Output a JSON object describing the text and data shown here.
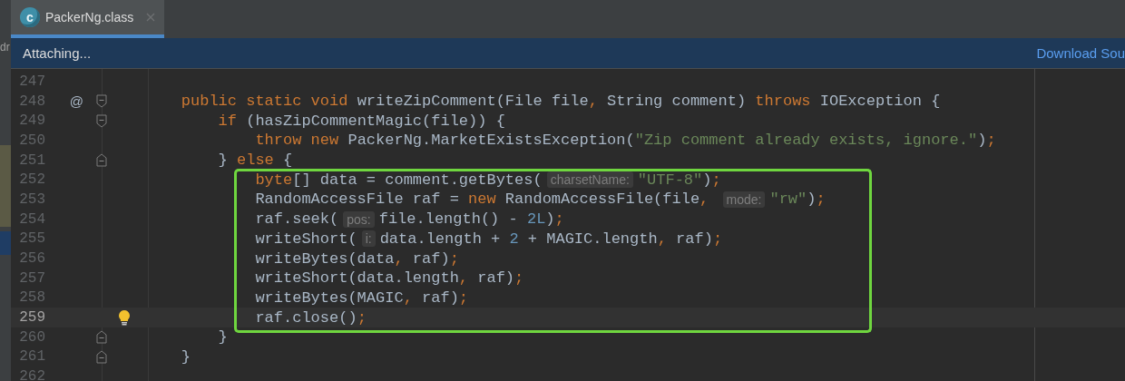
{
  "side_panel": {
    "text": "dr"
  },
  "tabs": [
    {
      "label": "PackerNg.class",
      "icon_text": "c",
      "selected": true,
      "closable": true
    }
  ],
  "banner": {
    "message": "Attaching...",
    "link": "Download Sou"
  },
  "lines": [
    {
      "number": "247",
      "current": false,
      "boxed": false,
      "bulb": false,
      "fold_open": false,
      "fold_close": false
    },
    {
      "number": "248",
      "current": false,
      "boxed": false,
      "bulb": false,
      "fold_open": true,
      "fold_close": false,
      "marker": "@",
      "tokens": [
        {
          "kind": "keyword",
          "text": "    public static void "
        },
        {
          "kind": "plain",
          "text": "writeZipComment(File file"
        },
        {
          "kind": "keyword",
          "text": ", "
        },
        {
          "kind": "plain",
          "text": "String comment) "
        },
        {
          "kind": "keyword",
          "text": "throws "
        },
        {
          "kind": "plain",
          "text": "IOException {"
        }
      ]
    },
    {
      "number": "249",
      "current": false,
      "boxed": false,
      "bulb": false,
      "fold_open": true,
      "fold_close": false,
      "tokens": [
        {
          "kind": "keyword",
          "text": "        if "
        },
        {
          "kind": "plain",
          "text": "(hasZipCommentMagic(file)) {"
        }
      ]
    },
    {
      "number": "250",
      "current": false,
      "boxed": false,
      "bulb": false,
      "fold_open": false,
      "fold_close": false,
      "tokens": [
        {
          "kind": "keyword",
          "text": "            throw new "
        },
        {
          "kind": "plain",
          "text": "PackerNg.MarketExistsException("
        },
        {
          "kind": "string",
          "text": "\"Zip comment already exists, ignore.\""
        },
        {
          "kind": "plain",
          "text": ")"
        },
        {
          "kind": "keyword",
          "text": ";"
        }
      ]
    },
    {
      "number": "251",
      "current": false,
      "boxed": false,
      "bulb": false,
      "fold_open": false,
      "fold_close": true,
      "tokens": [
        {
          "kind": "plain",
          "text": "        } "
        },
        {
          "kind": "keyword",
          "text": "else "
        },
        {
          "kind": "plain",
          "text": "{"
        }
      ]
    },
    {
      "number": "252",
      "current": false,
      "boxed": true,
      "bulb": false,
      "fold_open": false,
      "fold_close": false,
      "tokens": [
        {
          "kind": "keyword",
          "text": "            byte"
        },
        {
          "kind": "plain",
          "text": "[] data = comment.getBytes("
        },
        {
          "kind": "hint",
          "text": "charsetName:"
        },
        {
          "kind": "string",
          "text": "\"UTF-8\""
        },
        {
          "kind": "plain",
          "text": ")"
        },
        {
          "kind": "keyword",
          "text": ";"
        }
      ]
    },
    {
      "number": "253",
      "current": false,
      "boxed": true,
      "bulb": false,
      "fold_open": false,
      "fold_close": false,
      "tokens": [
        {
          "kind": "plain",
          "text": "            RandomAccessFile raf = "
        },
        {
          "kind": "keyword",
          "text": "new "
        },
        {
          "kind": "plain",
          "text": "RandomAccessFile(file"
        },
        {
          "kind": "keyword",
          "text": ", "
        },
        {
          "kind": "hint",
          "text": "mode:"
        },
        {
          "kind": "string",
          "text": "\"rw\""
        },
        {
          "kind": "plain",
          "text": ")"
        },
        {
          "kind": "keyword",
          "text": ";"
        }
      ]
    },
    {
      "number": "254",
      "current": false,
      "boxed": true,
      "bulb": false,
      "fold_open": false,
      "fold_close": false,
      "tokens": [
        {
          "kind": "plain",
          "text": "            raf.seek("
        },
        {
          "kind": "hint",
          "text": "pos:"
        },
        {
          "kind": "plain",
          "text": "file.length() - "
        },
        {
          "kind": "number",
          "text": "2L"
        },
        {
          "kind": "plain",
          "text": ")"
        },
        {
          "kind": "keyword",
          "text": ";"
        }
      ]
    },
    {
      "number": "255",
      "current": false,
      "boxed": true,
      "bulb": false,
      "fold_open": false,
      "fold_close": false,
      "tokens": [
        {
          "kind": "plain",
          "text": "            writeShort("
        },
        {
          "kind": "hint",
          "text": "i:"
        },
        {
          "kind": "plain",
          "text": "data.length + "
        },
        {
          "kind": "number",
          "text": "2"
        },
        {
          "kind": "plain",
          "text": " + MAGIC.length"
        },
        {
          "kind": "keyword",
          "text": ", "
        },
        {
          "kind": "plain",
          "text": "raf)"
        },
        {
          "kind": "keyword",
          "text": ";"
        }
      ]
    },
    {
      "number": "256",
      "current": false,
      "boxed": true,
      "bulb": false,
      "fold_open": false,
      "fold_close": false,
      "tokens": [
        {
          "kind": "plain",
          "text": "            writeBytes(data"
        },
        {
          "kind": "keyword",
          "text": ", "
        },
        {
          "kind": "plain",
          "text": "raf)"
        },
        {
          "kind": "keyword",
          "text": ";"
        }
      ]
    },
    {
      "number": "257",
      "current": false,
      "boxed": true,
      "bulb": false,
      "fold_open": false,
      "fold_close": false,
      "tokens": [
        {
          "kind": "plain",
          "text": "            writeShort(data.length"
        },
        {
          "kind": "keyword",
          "text": ", "
        },
        {
          "kind": "plain",
          "text": "raf)"
        },
        {
          "kind": "keyword",
          "text": ";"
        }
      ]
    },
    {
      "number": "258",
      "current": false,
      "boxed": true,
      "bulb": false,
      "fold_open": false,
      "fold_close": false,
      "tokens": [
        {
          "kind": "plain",
          "text": "            writeBytes(MAGIC"
        },
        {
          "kind": "keyword",
          "text": ", "
        },
        {
          "kind": "plain",
          "text": "raf)"
        },
        {
          "kind": "keyword",
          "text": ";"
        }
      ]
    },
    {
      "number": "259",
      "current": true,
      "boxed": true,
      "bulb": true,
      "fold_open": false,
      "fold_close": false,
      "tokens": [
        {
          "kind": "plain",
          "text": "            raf.close()"
        },
        {
          "kind": "keyword",
          "text": ";"
        }
      ]
    },
    {
      "number": "260",
      "current": false,
      "boxed": false,
      "bulb": false,
      "fold_open": false,
      "fold_close": true,
      "tokens": [
        {
          "kind": "plain",
          "text": "        }"
        }
      ]
    },
    {
      "number": "261",
      "current": false,
      "boxed": false,
      "bulb": false,
      "fold_open": false,
      "fold_close": true,
      "tokens": [
        {
          "kind": "plain",
          "text": "    }"
        }
      ]
    },
    {
      "number": "262",
      "current": false,
      "boxed": false,
      "bulb": false,
      "fold_open": false,
      "fold_close": false
    }
  ]
}
